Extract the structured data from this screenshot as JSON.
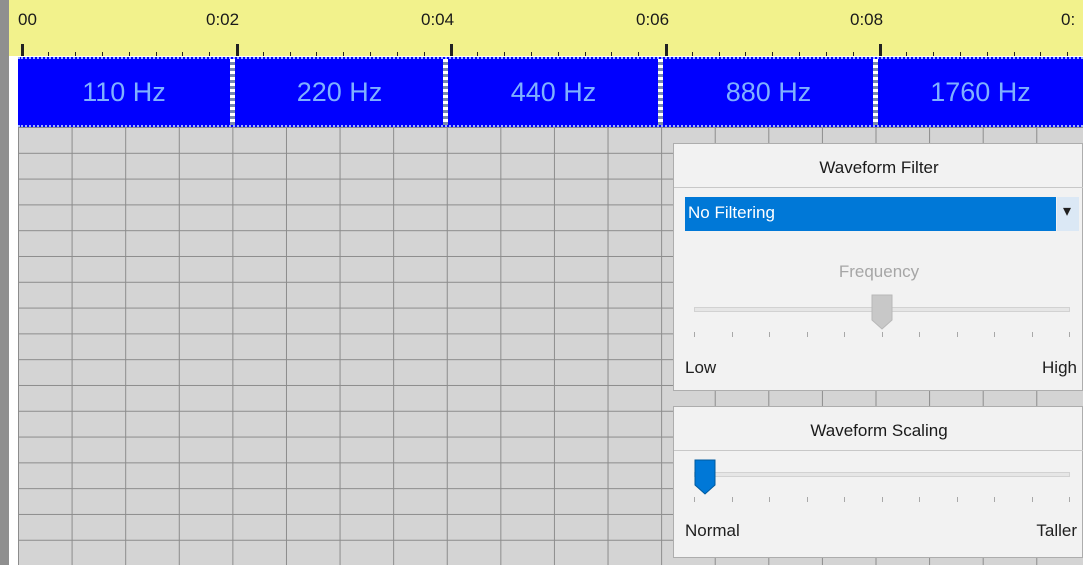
{
  "timeline": {
    "ruler_labels": [
      "00",
      "0:02",
      "0:04",
      "0:06",
      "0:08",
      "0:"
    ],
    "segments": [
      "110 Hz",
      "220 Hz",
      "440 Hz",
      "880 Hz",
      "1760 Hz"
    ]
  },
  "waveform_filter": {
    "title": "Waveform Filter",
    "selected_option": "No Filtering",
    "dropdown_arrow": "▾",
    "frequency_label": "Frequency",
    "frequency_level_fraction": 0.5,
    "low_label": "Low",
    "high_label": "High"
  },
  "waveform_scaling": {
    "title": "Waveform Scaling",
    "level_fraction": 0.0,
    "normal_label": "Normal",
    "taller_label": "Taller"
  },
  "colors": {
    "ruler_bg": "#f2f28c",
    "segment_bg": "#0000ff",
    "segment_text": "#7fb0ff",
    "selection_blue": "#0078d7",
    "grid_bg": "#d4d4d4"
  },
  "icons": {
    "dropdown": "chevron-down-icon",
    "frequency_thumb": "slider-thumb-icon",
    "scaling_thumb": "slider-thumb-icon"
  }
}
